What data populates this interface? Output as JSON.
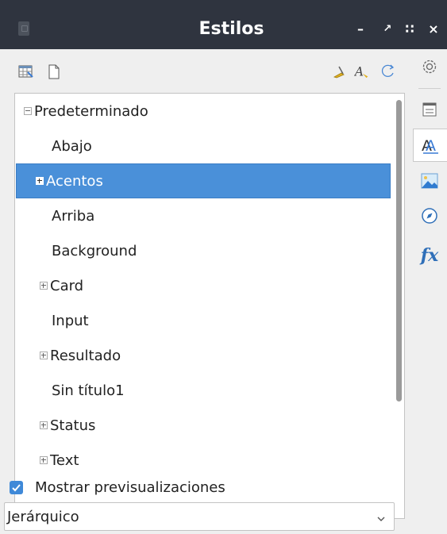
{
  "window": {
    "title": "Estilos",
    "controls": [
      "–",
      "↗",
      "∷",
      "×"
    ]
  },
  "toolbar": {
    "left_icons": [
      "styles-view-icon",
      "new-style-icon"
    ],
    "right_icons": [
      "fill-format-icon",
      "new-from-selection-icon",
      "update-style-icon"
    ]
  },
  "tree": {
    "items": [
      {
        "label": "Predeterminado",
        "expander": "minus",
        "level": 0
      },
      {
        "label": "Abajo",
        "expander": "none",
        "level": 1
      },
      {
        "label": "Acentos",
        "expander": "plus",
        "level": 1,
        "selected": true
      },
      {
        "label": "Arriba",
        "expander": "none",
        "level": 1
      },
      {
        "label": "Background",
        "expander": "none",
        "level": 1
      },
      {
        "label": "Card",
        "expander": "plus",
        "level": 1
      },
      {
        "label": "Input",
        "expander": "none",
        "level": 1
      },
      {
        "label": "Resultado",
        "expander": "plus",
        "level": 1
      },
      {
        "label": "Sin título1",
        "expander": "none",
        "level": 1
      },
      {
        "label": "Status",
        "expander": "plus",
        "level": 1
      },
      {
        "label": "Text",
        "expander": "plus",
        "level": 1
      }
    ]
  },
  "preview": {
    "label": "Mostrar previsualizaciones",
    "checked": true
  },
  "filter": {
    "value": "Jerárquico"
  },
  "sidebar": {
    "buttons": [
      "settings-icon",
      "properties-icon",
      "styles-icon",
      "gallery-icon",
      "navigator-icon",
      "functions-icon"
    ],
    "functions_label": "fx",
    "active": "styles-icon"
  },
  "colors": {
    "titlebar": "#2f343f",
    "selection": "#4a90d9",
    "accent": "#3f89d8"
  }
}
